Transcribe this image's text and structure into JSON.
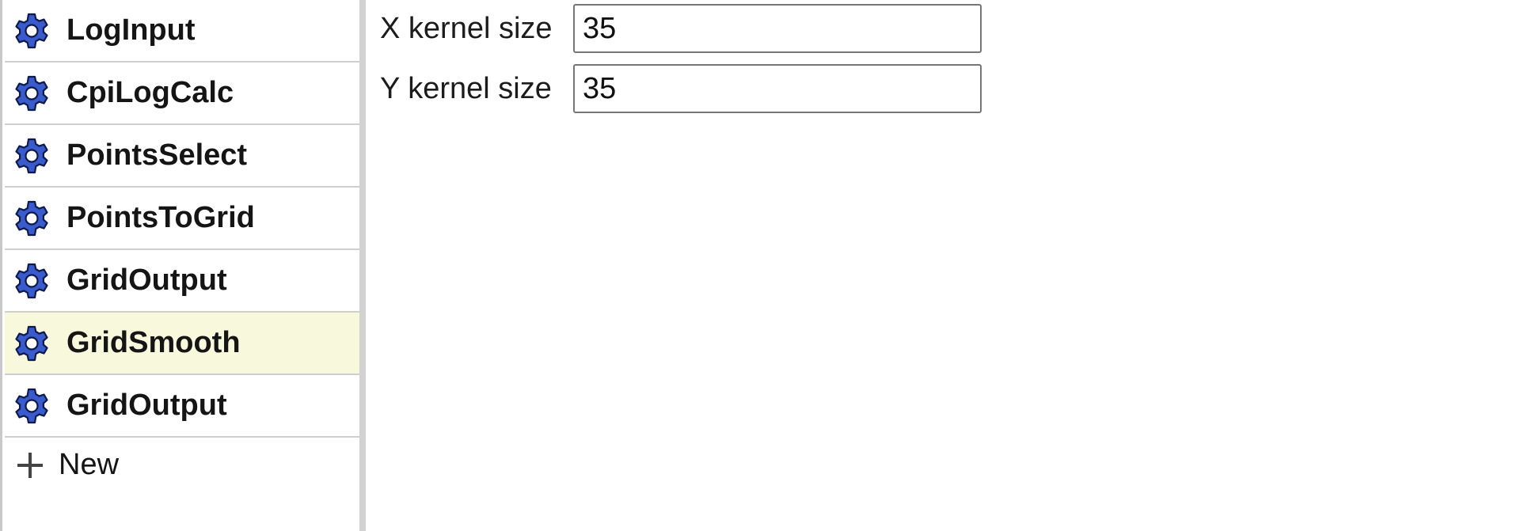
{
  "sidebar": {
    "steps": [
      {
        "label": "LogInput",
        "icon": "gear-icon",
        "selected": false
      },
      {
        "label": "CpiLogCalc",
        "icon": "gear-icon",
        "selected": false
      },
      {
        "label": "PointsSelect",
        "icon": "gear-icon",
        "selected": false
      },
      {
        "label": "PointsToGrid",
        "icon": "gear-icon",
        "selected": false
      },
      {
        "label": "GridOutput",
        "icon": "gear-icon",
        "selected": false
      },
      {
        "label": "GridSmooth",
        "icon": "gear-icon",
        "selected": true
      },
      {
        "label": "GridOutput",
        "icon": "gear-icon",
        "selected": false
      }
    ],
    "new_item": {
      "label": "New",
      "icon": "plus-icon"
    }
  },
  "params": {
    "x_kernel": {
      "label": "X kernel size",
      "value": "35"
    },
    "y_kernel": {
      "label": "Y kernel size",
      "value": "35"
    }
  },
  "colors": {
    "selected_bg": "#f8f8dc",
    "gear_fill": "#3a5bcc",
    "divider": "#cfcfcf"
  }
}
